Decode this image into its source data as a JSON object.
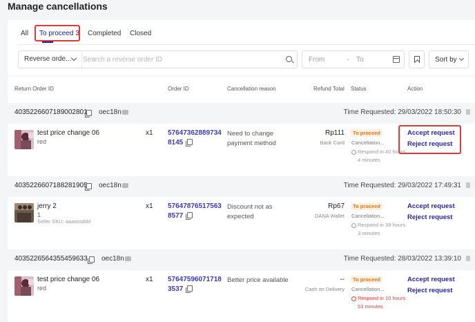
{
  "page": {
    "title": "Manage cancellations"
  },
  "tabs": [
    {
      "label": "All"
    },
    {
      "label": "To proceed 3"
    },
    {
      "label": "Completed"
    },
    {
      "label": "Closed"
    }
  ],
  "search": {
    "type_label": "Reverse orde...",
    "placeholder": "Search a reverse order ID",
    "date_from": "From",
    "date_sep": "-",
    "date_to": "To",
    "sort_label": "Sort by"
  },
  "table": {
    "headers": {
      "return_id": "Return Order ID",
      "order_id": "Order ID",
      "reason": "Cancellation reason",
      "refund": "Refund Total",
      "status": "Status",
      "action": "Action"
    },
    "orders": [
      {
        "return_id": "4035226607189002801",
        "buyer": "oec18n",
        "time_label": "Time Requested:",
        "time_value": "29/03/2022 18:50:30",
        "product": "test price change 06",
        "variant": "red",
        "sku": "",
        "qty": "x1",
        "order_id": "576473628897348145",
        "reason": "Need to change payment method",
        "amount": "Rp111",
        "payment": "Bank Card",
        "status": "To proceed",
        "status_sub": "Cancellation...",
        "respond": "Respond in 40 hours 4 minutes",
        "accept": "Accept request",
        "reject": "Reject request"
      },
      {
        "return_id": "4035226607188281905",
        "buyer": "oec18n",
        "time_label": "Time Requested:",
        "time_value": "29/03/2022 17:49:31",
        "product": "jerry 2",
        "variant": "1",
        "sku": "Seller SKU: aaasssddd",
        "qty": "x1",
        "order_id": "576478765175638577",
        "reason": "Discount not as expected",
        "amount": "Rp67",
        "payment": "DANA Wallet",
        "status": "To proceed",
        "status_sub": "Cancellation...",
        "respond": "Respond in 39 hours 3 minutes",
        "accept": "Accept request",
        "reject": "Reject request"
      },
      {
        "return_id": "4035226564355459633",
        "buyer": "oec18n",
        "time_label": "Time Requested:",
        "time_value": "28/03/2022 13:39:10",
        "product": "test price change 06",
        "variant": "red",
        "sku": "",
        "qty": "x1",
        "order_id": "576475960717183537",
        "reason": "Better price available",
        "amount": "--",
        "payment": "Cash on Delivery",
        "status": "To proceed",
        "status_sub": "Cancellation...",
        "respond": "Respond in 10 hours 53 minutes",
        "accept": "Accept request",
        "reject": "Reject request"
      }
    ]
  },
  "colors": {
    "accent": "#1a1a9e",
    "link": "#2626a8",
    "highlight_box": "#e53935",
    "status_orange": "#e8730c",
    "urgent_red": "#e53935"
  }
}
